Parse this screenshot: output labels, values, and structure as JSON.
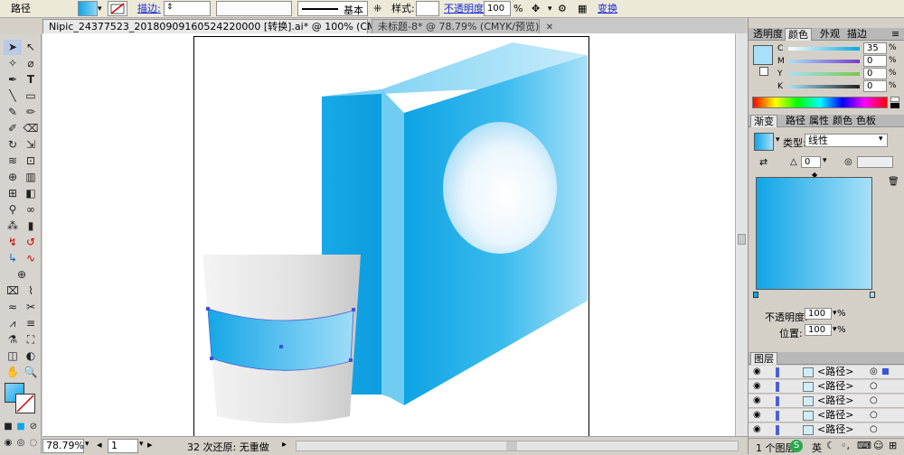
{
  "control_bar": {
    "object_type": "路径",
    "stroke_label": "描边:",
    "brush_label": "基本",
    "style_label": "样式:",
    "opacity_label": "不透明度:",
    "opacity_value": "100",
    "percent": "%",
    "transform_label": "变换"
  },
  "tabs": [
    {
      "label": "Nipic_24377523_20180909160524220000  [转换].ai* @ 100% (CMYK/预览)",
      "active": true
    },
    {
      "label": "未标题-8* @ 78.79% (CMYK/预览)",
      "active": false
    }
  ],
  "status_bar": {
    "zoom": "78.79%",
    "page": "1",
    "undo_text": "32 次还原: 无重做"
  },
  "transparency_panel": {
    "tabs": [
      "透明度",
      "颜色",
      "外观",
      "描边"
    ],
    "active_tab": 1,
    "channels": [
      {
        "label": "C",
        "value": "35"
      },
      {
        "label": "M",
        "value": "0"
      },
      {
        "label": "Y",
        "value": "0"
      },
      {
        "label": "K",
        "value": "0"
      }
    ]
  },
  "gradient_panel": {
    "tabs": [
      "渐变",
      "路径",
      "属性",
      "颜色",
      "色板"
    ],
    "active_tab": 0,
    "type_label": "类型:",
    "type_value": "线性",
    "angle_value": "0",
    "opacity_label": "不透明度:",
    "opacity_value": "100",
    "location_label": "位置:",
    "location_value": "100",
    "percent": "%"
  },
  "layers_panel": {
    "title": "图层",
    "rows": [
      "<路径>",
      "<路径>",
      "<路径>",
      "<路径>",
      "<路径>"
    ],
    "footer": "1 个图层",
    "ime": "英"
  },
  "colors": {
    "accent_blue": "#0fa5e6",
    "light_blue": "#8fd6f5",
    "link_blue": "#1a2bd6"
  }
}
